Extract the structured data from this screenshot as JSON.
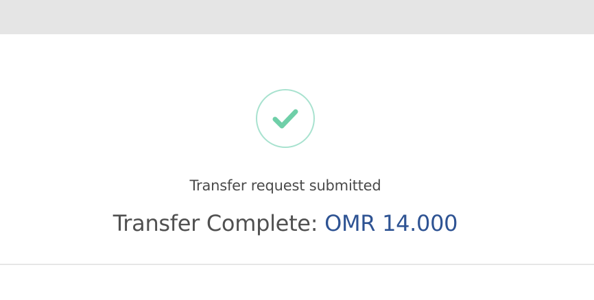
{
  "status": {
    "icon": "checkmark-icon",
    "subtitle": "Transfer request submitted",
    "label": "Transfer Complete:",
    "amount": "OMR 14.000"
  },
  "colors": {
    "check": "#6fcfa8",
    "circle_border": "#a8e2cf",
    "amount": "#2e5393",
    "label": "#505050",
    "top_bar": "#e5e5e5"
  }
}
